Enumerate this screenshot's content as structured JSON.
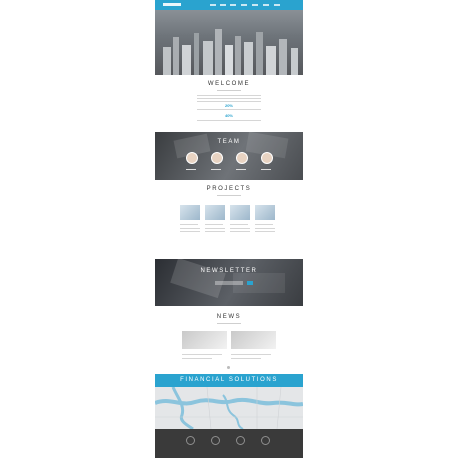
{
  "header": {
    "logo_text": "",
    "nav_items": [
      "",
      "",
      "",
      "",
      "",
      "",
      ""
    ]
  },
  "welcome": {
    "title": "WELCOME",
    "stat_1": "20%",
    "stat_2": "40%"
  },
  "team": {
    "title": "TEAM",
    "members": [
      "",
      "",
      "",
      ""
    ]
  },
  "projects": {
    "title": "PROJECTS",
    "items": [
      "",
      "",
      "",
      ""
    ]
  },
  "newsletter": {
    "title": "NEWSLETTER"
  },
  "news": {
    "title": "NEWS"
  },
  "financial": {
    "title": "FINANCIAL SOLUTIONS"
  },
  "footer": {
    "icons": [
      "circle-icon",
      "circle-icon",
      "circle-icon",
      "circle-icon"
    ]
  },
  "colors": {
    "accent": "#2aa3cf",
    "footer": "#3a3a3a"
  }
}
